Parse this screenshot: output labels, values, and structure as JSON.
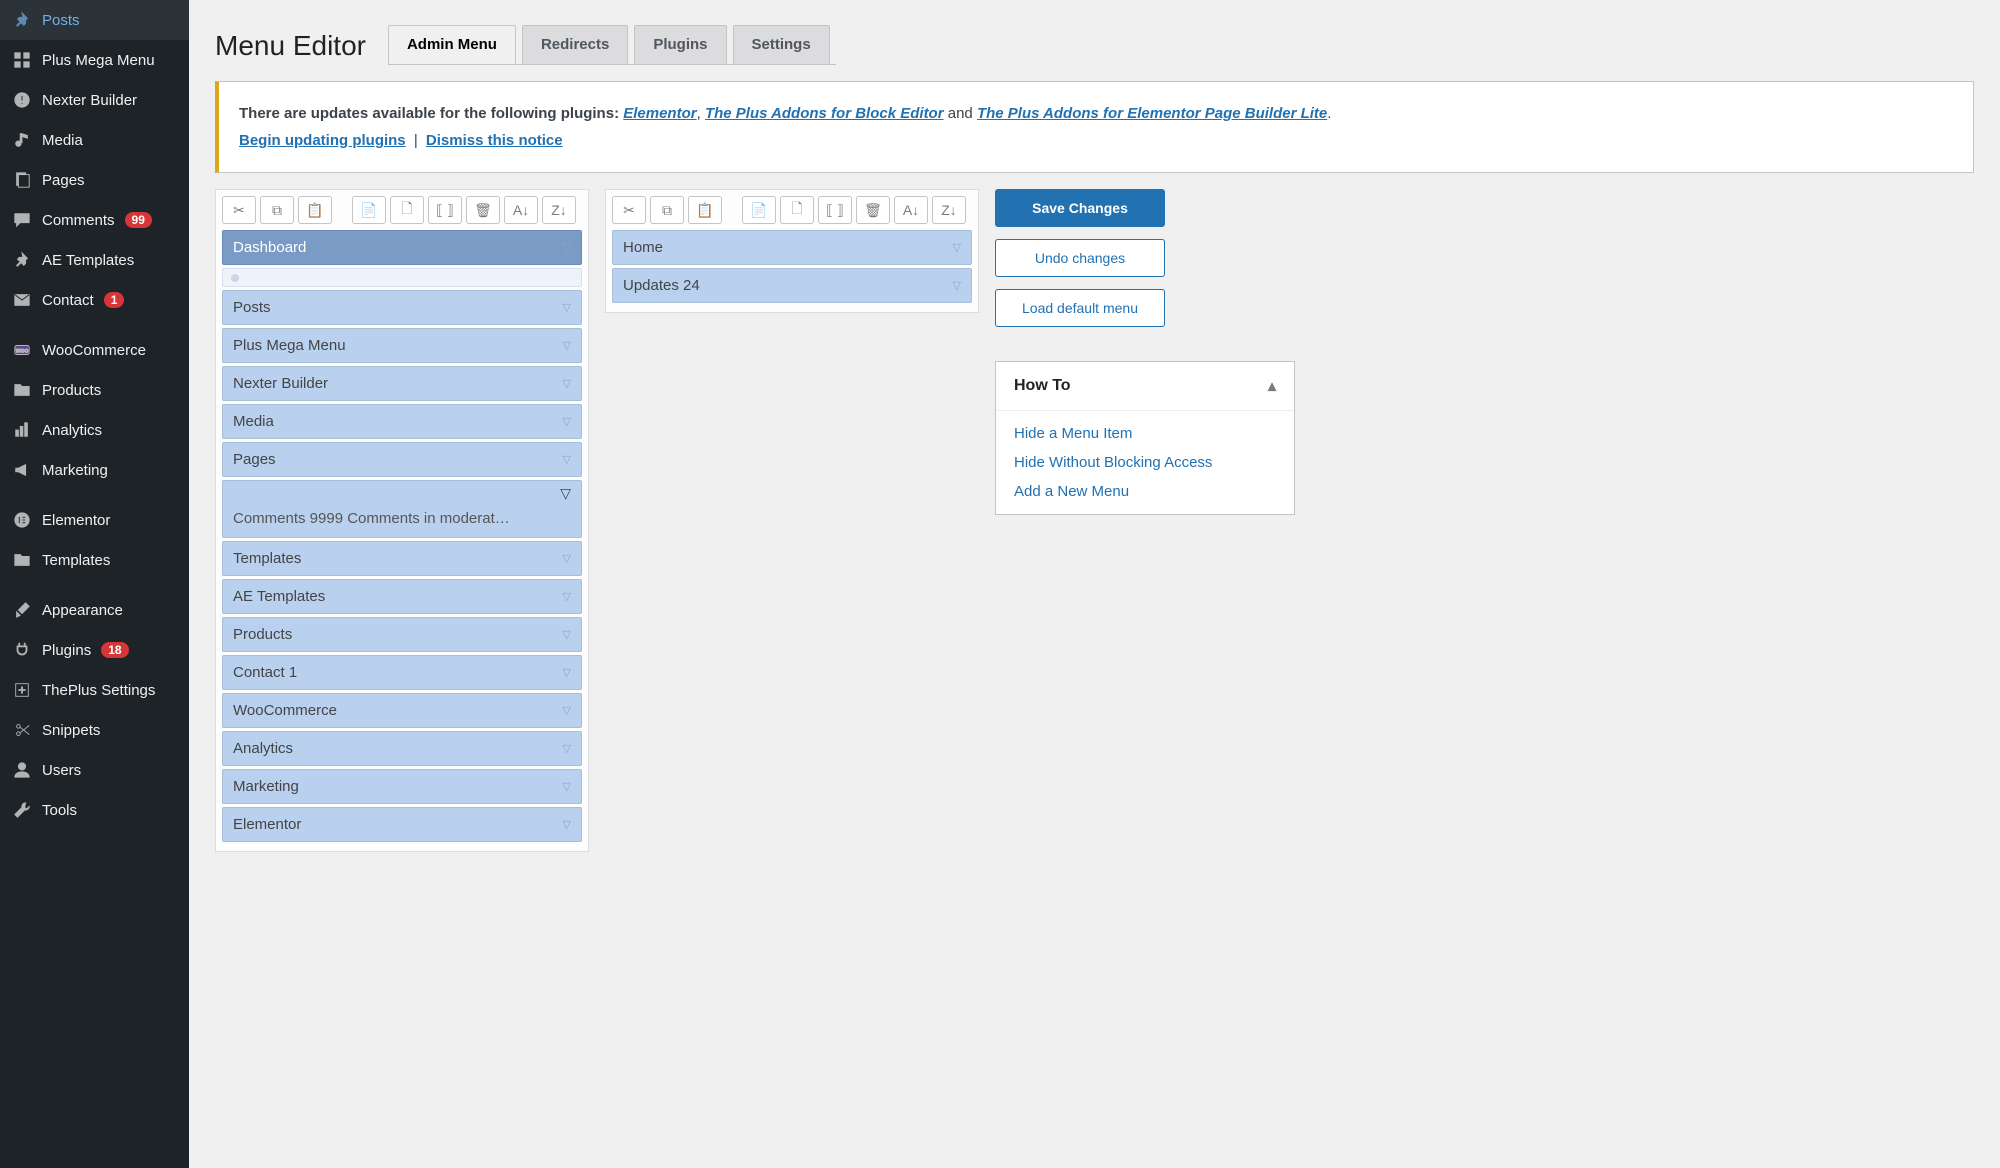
{
  "sidebar": [
    {
      "icon": "pin",
      "label": "Posts"
    },
    {
      "icon": "grid",
      "label": "Plus Mega Menu"
    },
    {
      "icon": "alert",
      "label": "Nexter Builder"
    },
    {
      "icon": "media",
      "label": "Media"
    },
    {
      "icon": "page",
      "label": "Pages"
    },
    {
      "icon": "comment",
      "label": "Comments",
      "badge": "99"
    },
    {
      "icon": "pin",
      "label": "AE Templates"
    },
    {
      "icon": "mail",
      "label": "Contact",
      "badge": "1"
    },
    {
      "icon": "woo",
      "label": "WooCommerce"
    },
    {
      "icon": "folder",
      "label": "Products"
    },
    {
      "icon": "bars",
      "label": "Analytics"
    },
    {
      "icon": "megaphone",
      "label": "Marketing"
    },
    {
      "icon": "elem",
      "label": "Elementor"
    },
    {
      "icon": "folder",
      "label": "Templates"
    },
    {
      "icon": "brush",
      "label": "Appearance"
    },
    {
      "icon": "plug",
      "label": "Plugins",
      "badge": "18"
    },
    {
      "icon": "plus",
      "label": "ThePlus Settings"
    },
    {
      "icon": "cut",
      "label": "Snippets"
    },
    {
      "icon": "user",
      "label": "Users"
    },
    {
      "icon": "wrench",
      "label": "Tools"
    }
  ],
  "title": "Menu Editor",
  "tabs": [
    "Admin Menu",
    "Redirects",
    "Plugins",
    "Settings"
  ],
  "notice": {
    "prefix": "There are updates available for the following plugins: ",
    "links": [
      "Elementor",
      "The Plus Addons for Block Editor",
      "The Plus Addons for Elementor Page Builder Lite"
    ],
    "mid": " and ",
    "suffix": ".",
    "begin": "Begin updating plugins",
    "sep": " | ",
    "dismiss": "Dismiss this notice"
  },
  "left_menu": [
    {
      "type": "item",
      "label": "Dashboard",
      "active": true
    },
    {
      "type": "sep"
    },
    {
      "type": "item",
      "label": "Posts"
    },
    {
      "type": "item",
      "label": "Plus Mega Menu"
    },
    {
      "type": "item",
      "label": "Nexter Builder"
    },
    {
      "type": "item",
      "label": "Media"
    },
    {
      "type": "item",
      "label": "Pages"
    },
    {
      "type": "sep2",
      "label": "Comments 9999 Comments in moderat…"
    },
    {
      "type": "item",
      "label": "Templates"
    },
    {
      "type": "item",
      "label": "AE Templates"
    },
    {
      "type": "item",
      "label": "Products"
    },
    {
      "type": "item",
      "label": "Contact 1"
    },
    {
      "type": "item",
      "label": "WooCommerce"
    },
    {
      "type": "item",
      "label": "Analytics"
    },
    {
      "type": "item",
      "label": "Marketing"
    },
    {
      "type": "item",
      "label": "Elementor"
    }
  ],
  "right_menu": [
    {
      "label": "Home"
    },
    {
      "label": "Updates 24"
    }
  ],
  "buttons": {
    "save": "Save Changes",
    "undo": "Undo changes",
    "load": "Load default menu"
  },
  "howto": {
    "title": "How To",
    "links": [
      "Hide a Menu Item",
      "Hide Without Blocking Access",
      "Add a New Menu"
    ]
  },
  "toolbar_icons": [
    "✂",
    "⧉",
    "📋",
    "",
    "📄+",
    "🗋+",
    "⟦⟧",
    "🗑",
    "A↓Z",
    "Z↓A"
  ]
}
